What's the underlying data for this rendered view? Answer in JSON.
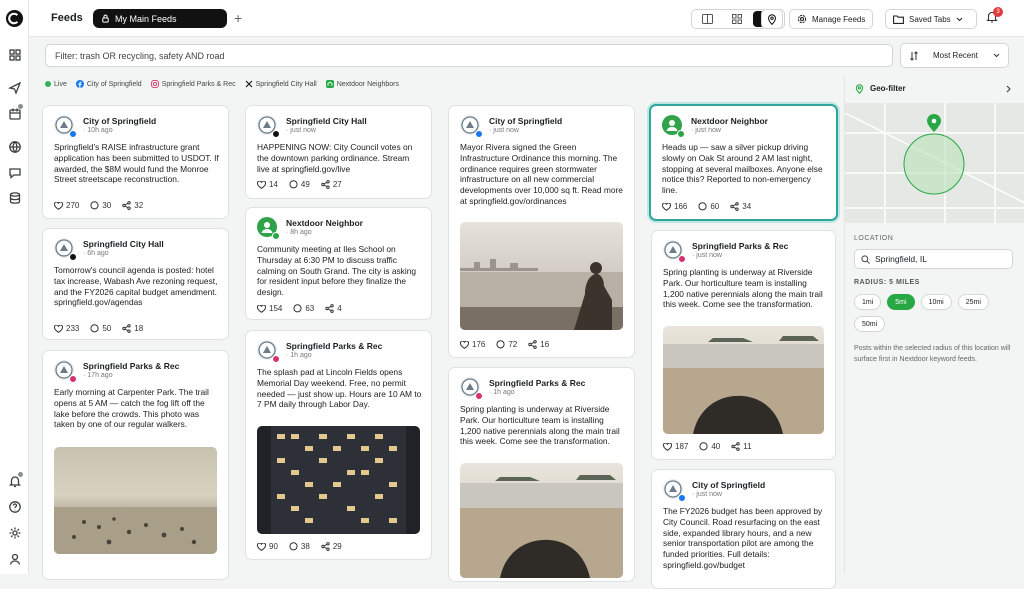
{
  "header": {
    "title": "Feeds",
    "active_tab": "My Main Feeds",
    "manage_feeds": "Manage Feeds",
    "saved_tabs": "Saved Tabs",
    "notif_count": "3"
  },
  "filter": {
    "query": "Filter: trash OR recycling, safety AND road",
    "sort": "Most Recent"
  },
  "sources": [
    "Live",
    "City of Springfield",
    "Springfield Parks & Rec",
    "Springfield City Hall",
    "Nextdoor Neighbors"
  ],
  "colors": {
    "accent": "#2fa59b",
    "green": "#28a745",
    "live": "#2fb35a"
  },
  "columns": [
    [
      {
        "author": "City of Springfield",
        "time": "10h ago",
        "text": "Springfield's RAISE infrastructure grant application has been submitted to USDOT. If awarded, the $8M would fund the Monroe Street streetscape reconstruction.",
        "likes": "270",
        "comments": "30",
        "shares": "32"
      },
      {
        "author": "Springfield City Hall",
        "time": "6h ago",
        "text": "Tomorrow's council agenda is posted: hotel tax increase, Wabash Ave rezoning request, and the FY2026 capital budget amendment. springfield.gov/agendas",
        "likes": "233",
        "comments": "50",
        "shares": "18"
      },
      {
        "author": "Springfield Parks & Rec",
        "time": "17h ago",
        "text": "Early morning at Carpenter Park. The trail opens at 5 AM — catch the fog lift off the lake before the crowds. This photo was taken by one of our regular walkers.",
        "likes": "139",
        "comments": "43",
        "shares": "6"
      }
    ],
    [
      {
        "author": "Springfield City Hall",
        "time": "just now",
        "text": "HAPPENING NOW: City Council votes on the downtown parking ordinance. Stream live at springfield.gov/live",
        "likes": "14",
        "comments": "49",
        "shares": "27"
      },
      {
        "author": "Nextdoor Neighbor",
        "time": "8h ago",
        "text": "Community meeting at Iles School on Thursday at 6:30 PM to discuss traffic calming on South Grand. The city is asking for resident input before they finalize the design.",
        "likes": "154",
        "comments": "63",
        "shares": "4"
      },
      {
        "author": "Springfield Parks & Rec",
        "time": "1h ago",
        "text": "The splash pad at Lincoln Fields opens Memorial Day weekend. Free, no permit needed — just show up. Hours are 10 AM to 7 PM daily through Labor Day.",
        "likes": "90",
        "comments": "38",
        "shares": "29"
      }
    ],
    [
      {
        "author": "City of Springfield",
        "time": "just now",
        "text": "Mayor Rivera signed the Green Infrastructure Ordinance this morning. The ordinance requires green stormwater infrastructure on all new commercial developments over 10,000 sq ft. Read more at springfield.gov/ordinances",
        "likes": "176",
        "comments": "72",
        "shares": "16"
      },
      {
        "author": "Springfield Parks & Rec",
        "time": "1h ago",
        "text": "Spring planting is underway at Riverside Park. Our horticulture team is installing 1,200 native perennials along the main trail this week. Come see the transformation.",
        "likes": "",
        "comments": "",
        "shares": ""
      }
    ],
    [
      {
        "author": "Nextdoor Neighbor",
        "time": "just now",
        "text": "Heads up — saw a silver pickup driving slowly on Oak St around 2 AM last night, stopping at several mailboxes. Anyone else notice this? Reported to non-emergency line.",
        "likes": "166",
        "comments": "60",
        "shares": "34"
      },
      {
        "author": "Springfield Parks & Rec",
        "time": "just now",
        "text": "Spring planting is underway at Riverside Park. Our horticulture team is installing 1,200 native perennials along the main trail this week. Come see the transformation.",
        "likes": "187",
        "comments": "40",
        "shares": "11"
      },
      {
        "author": "City of Springfield",
        "time": "just now",
        "text": "The FY2026 budget has been approved by City Council. Road resurfacing on the east side, expanded library hours, and a new senior transportation pilot are among the funded priorities. Full details: springfield.gov/budget",
        "likes": "",
        "comments": "",
        "shares": ""
      }
    ]
  ],
  "geo": {
    "title": "Geo-filter",
    "location_label": "LOCATION",
    "location": "Springfield, IL",
    "radius_label": "RADIUS: 5 MILES",
    "radii": [
      "1mi",
      "5mi",
      "10mi",
      "25mi",
      "50mi"
    ],
    "selected": "5mi",
    "note": "Posts within the selected radius of this location will surface first in Nextdoor keyword feeds."
  }
}
